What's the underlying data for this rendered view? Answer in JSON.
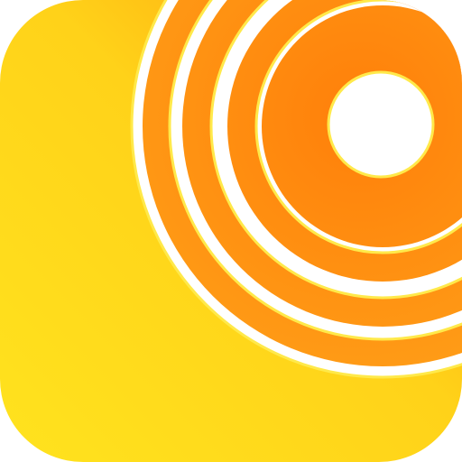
{
  "icon": {
    "semantic": "concentric-rings-app-icon",
    "colors": {
      "background_top_left": "#ffd219",
      "background_bottom_left": "#ffe31e",
      "background_corner_orange": "#ff9a0c",
      "ring_outer": "#ffa51a",
      "ring_inner": "#ff7f0a",
      "ring_gap": "#ffffff",
      "ring_outline": "#ffe94a",
      "center_dot": "#ffffff"
    }
  }
}
